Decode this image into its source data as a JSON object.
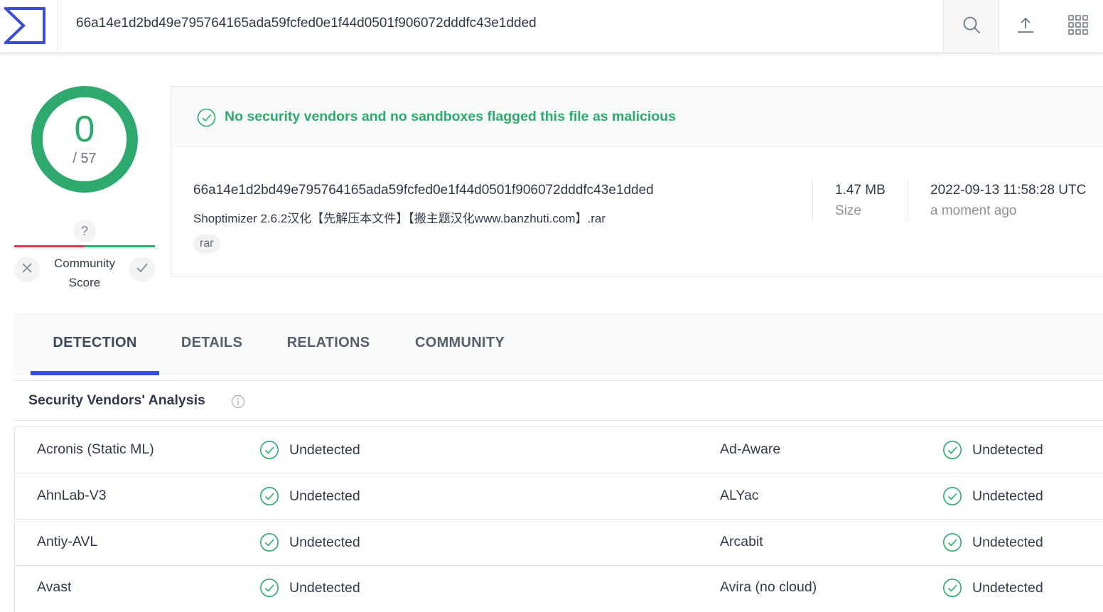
{
  "colors": {
    "accent": "#3a4ce0",
    "clean": "#2faa6e",
    "negative": "#e0364f",
    "text": "#2f3a4a"
  },
  "header": {
    "logo_icon": "sigma-logo-icon",
    "search_value": "66a14e1d2bd49e795764165ada59fcfed0e1f44d0501f906072dddfc43e1dded",
    "search_icon": "search-icon",
    "upload_icon": "upload-icon",
    "apps_icon": "apps-grid-icon"
  },
  "score": {
    "detections": "0",
    "total": "/ 57",
    "community_question": "?",
    "community_label": "Community Score",
    "community_negative_fraction": 0.5,
    "vote_down_icon": "close-icon",
    "vote_up_icon": "check-icon"
  },
  "summary": {
    "banner": "No security vendors and no sandboxes flagged this file as malicious",
    "banner_icon": "check-circle-icon",
    "hash": "66a14e1d2bd49e795764165ada59fcfed0e1f44d0501f906072dddfc43e1dded",
    "filename": "Shoptimizer 2.6.2汉化【先解压本文件】【搬主题汉化www.banzhuti.com】.rar",
    "tag": "rar",
    "size_value": "1.47 MB",
    "size_label": "Size",
    "date_value": "2022-09-13 11:58:28 UTC",
    "date_label": "a moment ago"
  },
  "tabs": [
    {
      "label": "DETECTION",
      "active": true
    },
    {
      "label": "DETAILS",
      "active": false
    },
    {
      "label": "RELATIONS",
      "active": false
    },
    {
      "label": "COMMUNITY",
      "active": false
    }
  ],
  "analysis": {
    "title": "Security Vendors' Analysis",
    "info_icon": "info-icon",
    "rows": [
      {
        "left_vendor": "Acronis (Static ML)",
        "left_result": "Undetected",
        "right_vendor": "Ad-Aware",
        "right_result": "Undetected"
      },
      {
        "left_vendor": "AhnLab-V3",
        "left_result": "Undetected",
        "right_vendor": "ALYac",
        "right_result": "Undetected"
      },
      {
        "left_vendor": "Antiy-AVL",
        "left_result": "Undetected",
        "right_vendor": "Arcabit",
        "right_result": "Undetected"
      },
      {
        "left_vendor": "Avast",
        "left_result": "Undetected",
        "right_vendor": "Avira (no cloud)",
        "right_result": "Undetected"
      }
    ]
  }
}
